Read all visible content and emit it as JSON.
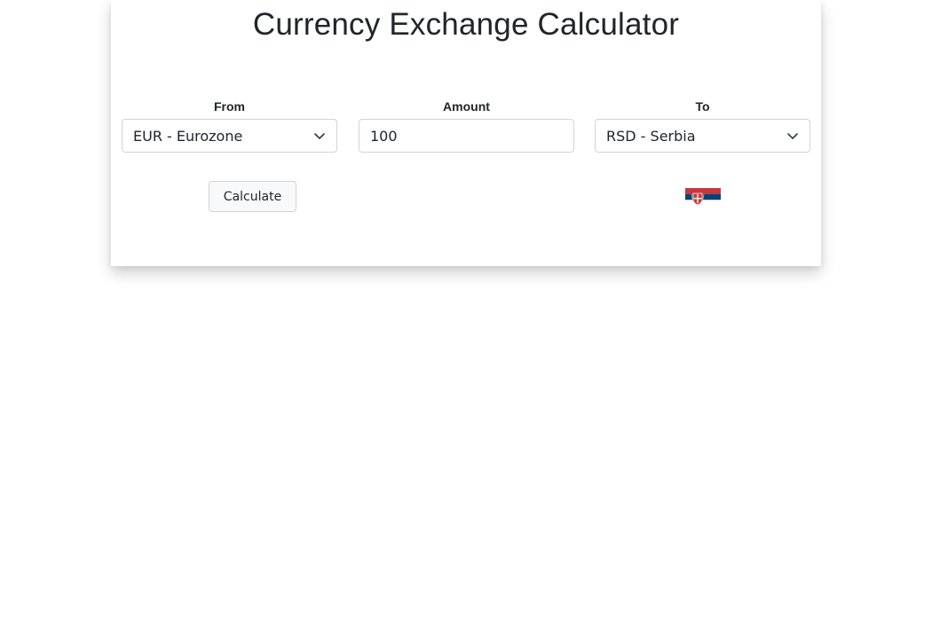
{
  "page": {
    "title": "Currency Exchange Calculator"
  },
  "form": {
    "from": {
      "label": "From",
      "selected": "EUR - Eurozone"
    },
    "amount": {
      "label": "Amount",
      "value": "100"
    },
    "to": {
      "label": "To",
      "selected": "RSD - Serbia"
    },
    "calculate_label": "Calculate",
    "flag_icon": "serbia-flag-icon"
  },
  "colors": {
    "border": "#ced4da",
    "button_bg": "#f8f9fa",
    "text": "#212529",
    "flag_red": "#c6363c",
    "flag_blue": "#0c4076",
    "flag_white": "#ffffff"
  }
}
